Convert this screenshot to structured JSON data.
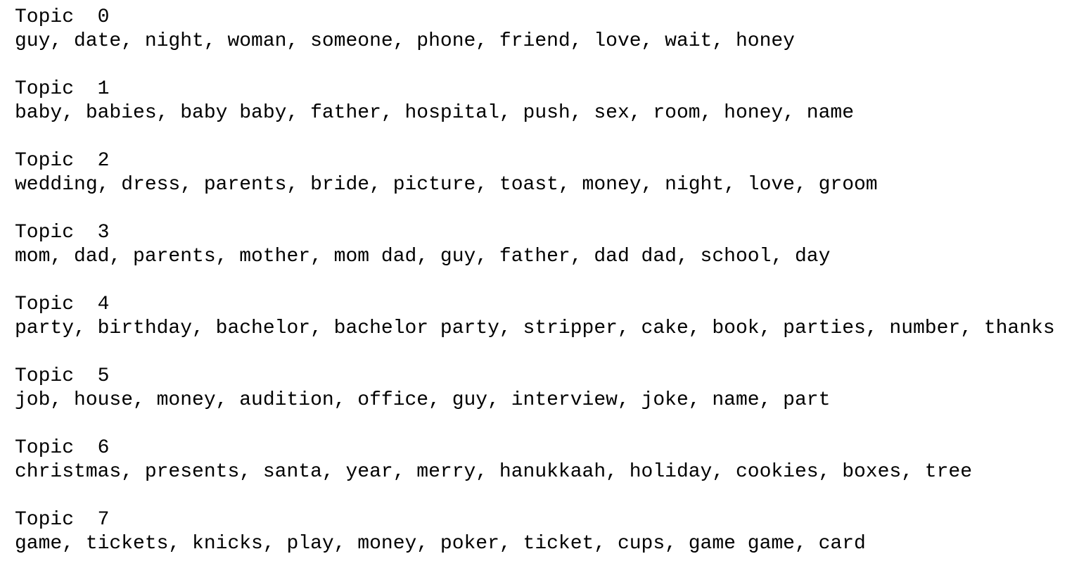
{
  "topics": [
    {
      "label": "Topic",
      "number": "0",
      "words": "guy, date, night, woman, someone, phone, friend, love, wait, honey"
    },
    {
      "label": "Topic",
      "number": "1",
      "words": "baby, babies, baby baby, father, hospital, push, sex, room, honey, name"
    },
    {
      "label": "Topic",
      "number": "2",
      "words": "wedding, dress, parents, bride, picture, toast, money, night, love, groom"
    },
    {
      "label": "Topic",
      "number": "3",
      "words": "mom, dad, parents, mother, mom dad, guy, father, dad dad, school, day"
    },
    {
      "label": "Topic",
      "number": "4",
      "words": "party, birthday, bachelor, bachelor party, stripper, cake, book, parties, number, thanks"
    },
    {
      "label": "Topic",
      "number": "5",
      "words": "job, house, money, audition, office, guy, interview, joke, name, part"
    },
    {
      "label": "Topic",
      "number": "6",
      "words": "christmas, presents, santa, year, merry, hanukkaah, holiday, cookies, boxes, tree"
    },
    {
      "label": "Topic",
      "number": "7",
      "words": "game, tickets, knicks, play, money, poker, ticket, cups, game game, card"
    }
  ]
}
